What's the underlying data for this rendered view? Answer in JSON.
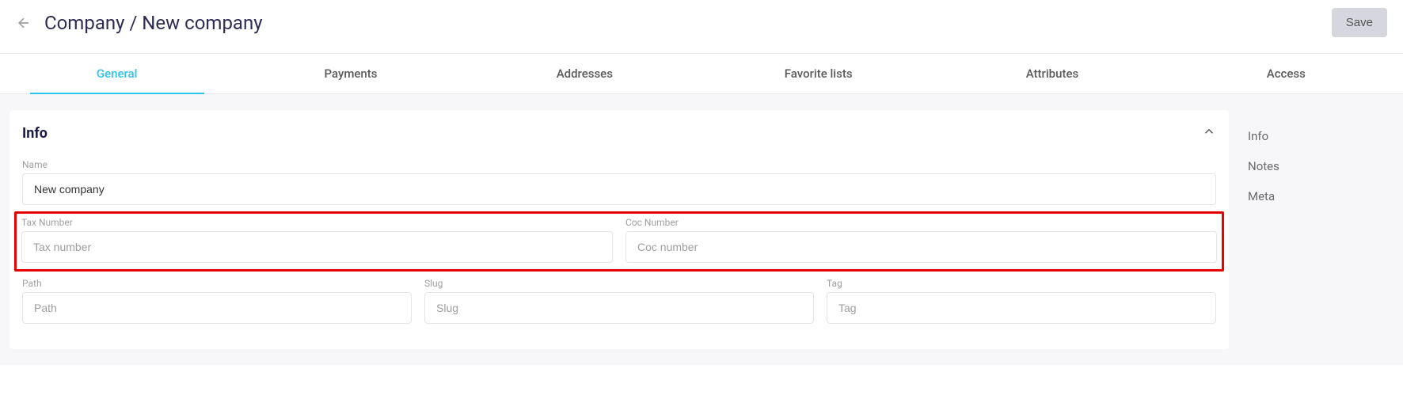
{
  "header": {
    "breadcrumb": "Company / New company",
    "save_label": "Save"
  },
  "tabs": [
    {
      "label": "General",
      "active": true
    },
    {
      "label": "Payments",
      "active": false
    },
    {
      "label": "Addresses",
      "active": false
    },
    {
      "label": "Favorite lists",
      "active": false
    },
    {
      "label": "Attributes",
      "active": false
    },
    {
      "label": "Access",
      "active": false
    }
  ],
  "panel": {
    "title": "Info",
    "fields": {
      "name": {
        "label": "Name",
        "value": "New company",
        "placeholder": ""
      },
      "tax_number": {
        "label": "Tax Number",
        "value": "",
        "placeholder": "Tax number"
      },
      "coc_number": {
        "label": "Coc Number",
        "value": "",
        "placeholder": "Coc number"
      },
      "path": {
        "label": "Path",
        "value": "",
        "placeholder": "Path"
      },
      "slug": {
        "label": "Slug",
        "value": "",
        "placeholder": "Slug"
      },
      "tag": {
        "label": "Tag",
        "value": "",
        "placeholder": "Tag"
      }
    }
  },
  "sidebar": {
    "items": [
      {
        "label": "Info"
      },
      {
        "label": "Notes"
      },
      {
        "label": "Meta"
      }
    ]
  }
}
